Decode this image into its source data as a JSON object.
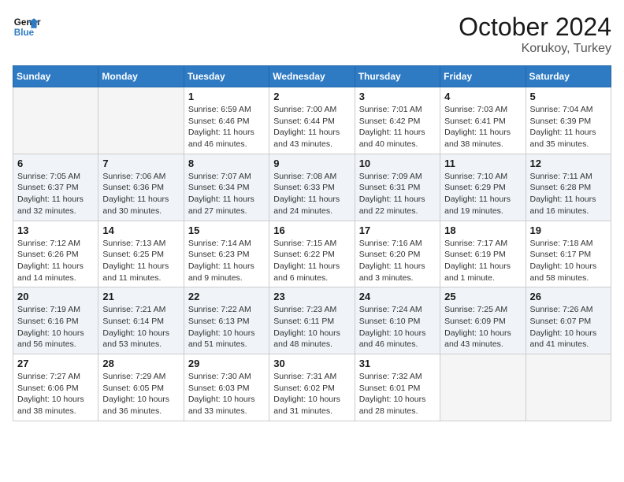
{
  "header": {
    "logo_line1": "General",
    "logo_line2": "Blue",
    "month": "October 2024",
    "location": "Korukoy, Turkey"
  },
  "days_of_week": [
    "Sunday",
    "Monday",
    "Tuesday",
    "Wednesday",
    "Thursday",
    "Friday",
    "Saturday"
  ],
  "weeks": [
    [
      {
        "day": "",
        "empty": true
      },
      {
        "day": "",
        "empty": true
      },
      {
        "day": "1",
        "sunrise": "6:59 AM",
        "sunset": "6:46 PM",
        "daylight": "11 hours and 46 minutes."
      },
      {
        "day": "2",
        "sunrise": "7:00 AM",
        "sunset": "6:44 PM",
        "daylight": "11 hours and 43 minutes."
      },
      {
        "day": "3",
        "sunrise": "7:01 AM",
        "sunset": "6:42 PM",
        "daylight": "11 hours and 40 minutes."
      },
      {
        "day": "4",
        "sunrise": "7:03 AM",
        "sunset": "6:41 PM",
        "daylight": "11 hours and 38 minutes."
      },
      {
        "day": "5",
        "sunrise": "7:04 AM",
        "sunset": "6:39 PM",
        "daylight": "11 hours and 35 minutes."
      }
    ],
    [
      {
        "day": "6",
        "sunrise": "7:05 AM",
        "sunset": "6:37 PM",
        "daylight": "11 hours and 32 minutes."
      },
      {
        "day": "7",
        "sunrise": "7:06 AM",
        "sunset": "6:36 PM",
        "daylight": "11 hours and 30 minutes."
      },
      {
        "day": "8",
        "sunrise": "7:07 AM",
        "sunset": "6:34 PM",
        "daylight": "11 hours and 27 minutes."
      },
      {
        "day": "9",
        "sunrise": "7:08 AM",
        "sunset": "6:33 PM",
        "daylight": "11 hours and 24 minutes."
      },
      {
        "day": "10",
        "sunrise": "7:09 AM",
        "sunset": "6:31 PM",
        "daylight": "11 hours and 22 minutes."
      },
      {
        "day": "11",
        "sunrise": "7:10 AM",
        "sunset": "6:29 PM",
        "daylight": "11 hours and 19 minutes."
      },
      {
        "day": "12",
        "sunrise": "7:11 AM",
        "sunset": "6:28 PM",
        "daylight": "11 hours and 16 minutes."
      }
    ],
    [
      {
        "day": "13",
        "sunrise": "7:12 AM",
        "sunset": "6:26 PM",
        "daylight": "11 hours and 14 minutes."
      },
      {
        "day": "14",
        "sunrise": "7:13 AM",
        "sunset": "6:25 PM",
        "daylight": "11 hours and 11 minutes."
      },
      {
        "day": "15",
        "sunrise": "7:14 AM",
        "sunset": "6:23 PM",
        "daylight": "11 hours and 9 minutes."
      },
      {
        "day": "16",
        "sunrise": "7:15 AM",
        "sunset": "6:22 PM",
        "daylight": "11 hours and 6 minutes."
      },
      {
        "day": "17",
        "sunrise": "7:16 AM",
        "sunset": "6:20 PM",
        "daylight": "11 hours and 3 minutes."
      },
      {
        "day": "18",
        "sunrise": "7:17 AM",
        "sunset": "6:19 PM",
        "daylight": "11 hours and 1 minute."
      },
      {
        "day": "19",
        "sunrise": "7:18 AM",
        "sunset": "6:17 PM",
        "daylight": "10 hours and 58 minutes."
      }
    ],
    [
      {
        "day": "20",
        "sunrise": "7:19 AM",
        "sunset": "6:16 PM",
        "daylight": "10 hours and 56 minutes."
      },
      {
        "day": "21",
        "sunrise": "7:21 AM",
        "sunset": "6:14 PM",
        "daylight": "10 hours and 53 minutes."
      },
      {
        "day": "22",
        "sunrise": "7:22 AM",
        "sunset": "6:13 PM",
        "daylight": "10 hours and 51 minutes."
      },
      {
        "day": "23",
        "sunrise": "7:23 AM",
        "sunset": "6:11 PM",
        "daylight": "10 hours and 48 minutes."
      },
      {
        "day": "24",
        "sunrise": "7:24 AM",
        "sunset": "6:10 PM",
        "daylight": "10 hours and 46 minutes."
      },
      {
        "day": "25",
        "sunrise": "7:25 AM",
        "sunset": "6:09 PM",
        "daylight": "10 hours and 43 minutes."
      },
      {
        "day": "26",
        "sunrise": "7:26 AM",
        "sunset": "6:07 PM",
        "daylight": "10 hours and 41 minutes."
      }
    ],
    [
      {
        "day": "27",
        "sunrise": "7:27 AM",
        "sunset": "6:06 PM",
        "daylight": "10 hours and 38 minutes."
      },
      {
        "day": "28",
        "sunrise": "7:29 AM",
        "sunset": "6:05 PM",
        "daylight": "10 hours and 36 minutes."
      },
      {
        "day": "29",
        "sunrise": "7:30 AM",
        "sunset": "6:03 PM",
        "daylight": "10 hours and 33 minutes."
      },
      {
        "day": "30",
        "sunrise": "7:31 AM",
        "sunset": "6:02 PM",
        "daylight": "10 hours and 31 minutes."
      },
      {
        "day": "31",
        "sunrise": "7:32 AM",
        "sunset": "6:01 PM",
        "daylight": "10 hours and 28 minutes."
      },
      {
        "day": "",
        "empty": true
      },
      {
        "day": "",
        "empty": true
      }
    ]
  ],
  "labels": {
    "sunrise": "Sunrise:",
    "sunset": "Sunset:",
    "daylight": "Daylight:"
  }
}
